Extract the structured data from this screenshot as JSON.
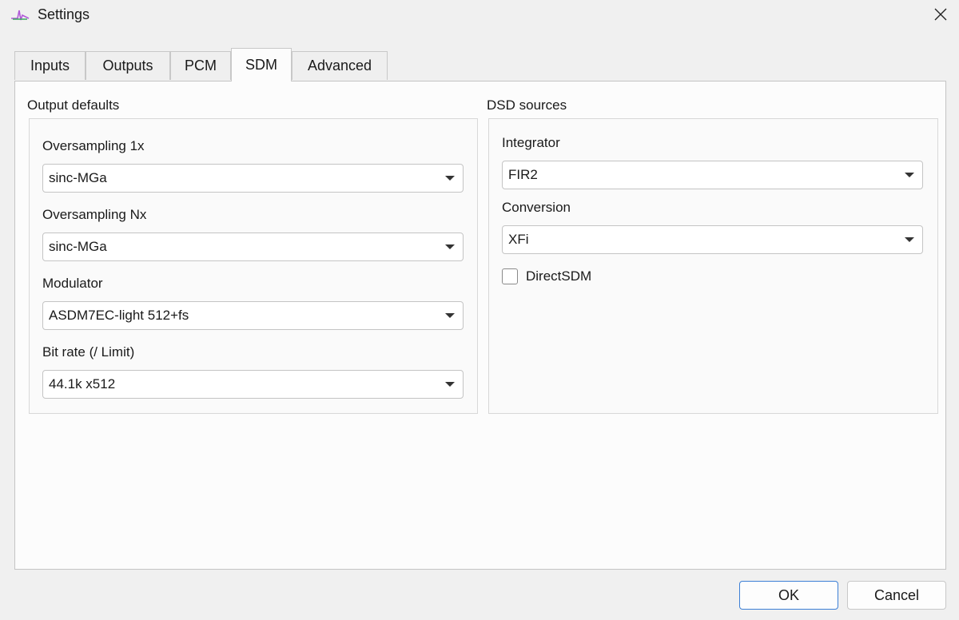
{
  "window": {
    "title": "Settings"
  },
  "tabs": [
    {
      "label": "Inputs"
    },
    {
      "label": "Outputs"
    },
    {
      "label": "PCM"
    },
    {
      "label": "SDM",
      "active": true
    },
    {
      "label": "Advanced"
    }
  ],
  "output_defaults": {
    "heading": "Output defaults",
    "fields": [
      {
        "label": "Oversampling 1x",
        "value": "sinc-MGa"
      },
      {
        "label": "Oversampling Nx",
        "value": "sinc-MGa"
      },
      {
        "label": "Modulator",
        "value": "ASDM7EC-light 512+fs"
      },
      {
        "label": "Bit rate (/ Limit)",
        "value": "44.1k x512"
      }
    ]
  },
  "dsd_sources": {
    "heading": "DSD sources",
    "fields": [
      {
        "label": "Integrator",
        "value": "FIR2"
      },
      {
        "label": "Conversion",
        "value": "XFi"
      }
    ],
    "direct_sdm": {
      "label": "DirectSDM",
      "checked": false
    }
  },
  "buttons": {
    "ok": "OK",
    "cancel": "Cancel"
  },
  "colors": {
    "accent": "#3c7fd6",
    "panel": "#fcfcfc",
    "window": "#f0f0f0"
  }
}
